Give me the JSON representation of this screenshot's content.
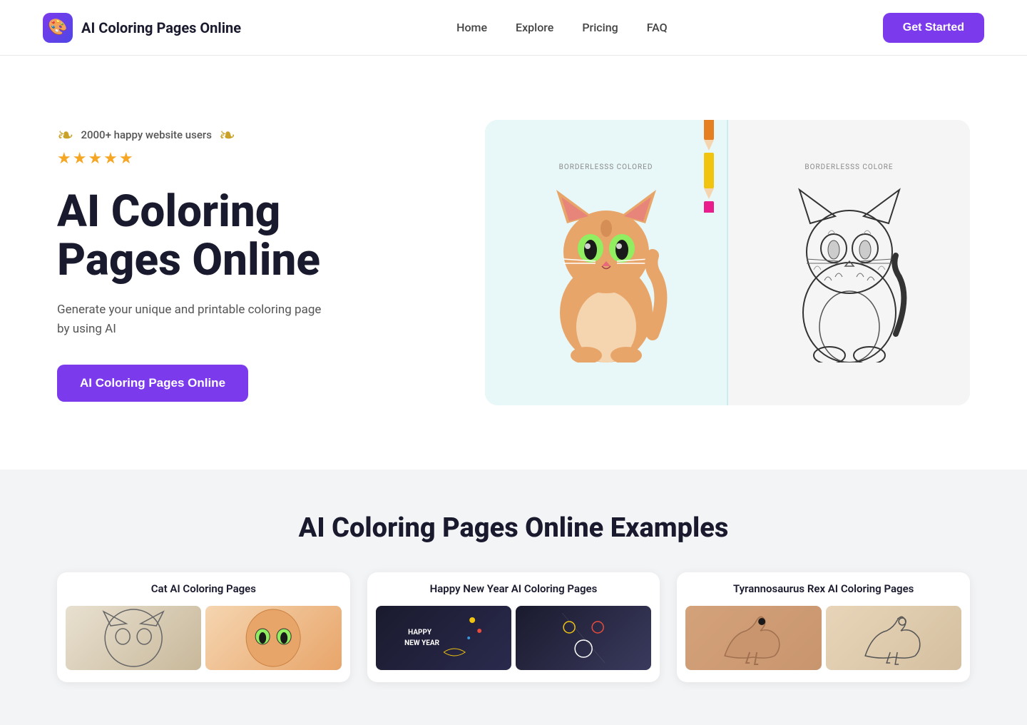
{
  "nav": {
    "logo_emoji": "🎨",
    "brand_name": "AI Coloring Pages Online",
    "links": [
      {
        "label": "Home",
        "href": "#"
      },
      {
        "label": "Explore",
        "href": "#"
      },
      {
        "label": "Pricing",
        "href": "#"
      },
      {
        "label": "FAQ",
        "href": "#"
      }
    ],
    "cta_button": "Get Started"
  },
  "hero": {
    "social_proof_text": "2000+ happy website users",
    "stars": "★★★★★",
    "heading_line1": "AI Coloring",
    "heading_line2": "Pages Online",
    "subtext": "Generate your unique and printable coloring page by using AI",
    "cta_button": "AI Coloring Pages Online",
    "left_label": "BORDERLESSS COLORED",
    "right_label": "BORDERLESSS COLORE"
  },
  "examples": {
    "section_title": "AI Coloring Pages Online Examples",
    "cards": [
      {
        "title": "Cat AI Coloring Pages"
      },
      {
        "title": "Happy New Year AI Coloring Pages"
      },
      {
        "title": "Tyrannosaurus Rex AI Coloring Pages"
      }
    ]
  }
}
